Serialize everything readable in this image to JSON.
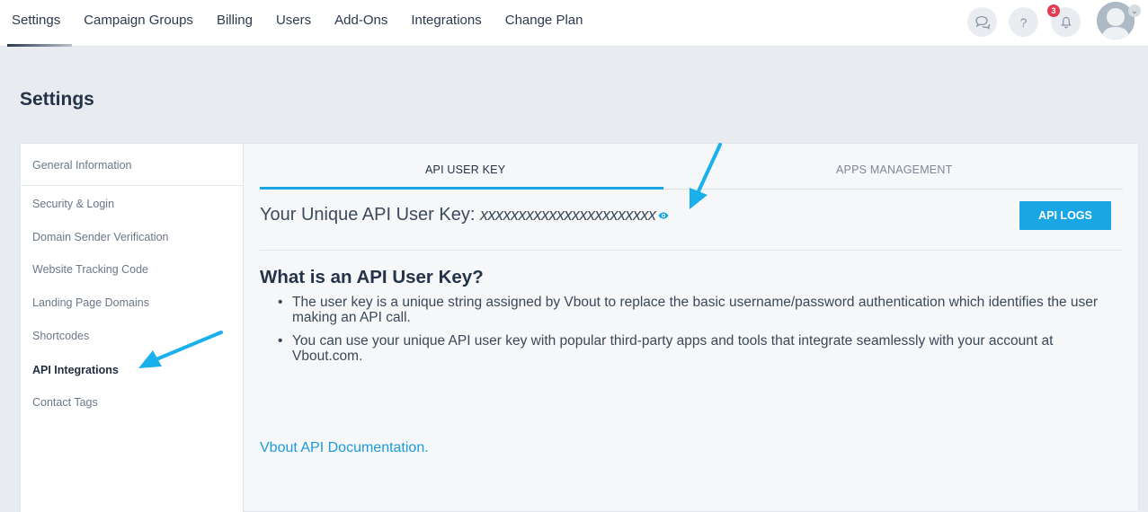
{
  "nav": {
    "items": [
      "Settings",
      "Campaign Groups",
      "Billing",
      "Users",
      "Add-Ons",
      "Integrations",
      "Change Plan"
    ],
    "active": "Settings"
  },
  "header_icons": {
    "chat": "chat-icon",
    "help": "?",
    "notifications_count": "3",
    "bell": "bell-icon"
  },
  "page_title": "Settings",
  "sidebar": {
    "items": [
      "General Information",
      "Security & Login",
      "Domain Sender Verification",
      "Website Tracking Code",
      "Landing Page Domains",
      "Shortcodes",
      "API Integrations",
      "Contact Tags"
    ],
    "active": "API Integrations"
  },
  "tabs": [
    "API USER KEY",
    "APPS MANAGEMENT"
  ],
  "api_key": {
    "label": "Your Unique API User Key:",
    "value": "xxxxxxxxxxxxxxxxxxxxxxx",
    "logs_button": "API LOGS"
  },
  "about": {
    "title": "What is an API User Key?",
    "bullets": [
      "The user key is a unique string assigned by Vbout to replace the basic username/password authentication which identifies the user making an API call.",
      "You can use your unique API user key with popular third-party apps and tools that integrate seamlessly with your account at Vbout.com."
    ]
  },
  "doc_link": "Vbout API Documentation.",
  "colors": {
    "accent": "#1aa6e4",
    "annotation_arrow": "#1ab0ec",
    "badge": "#e23d51",
    "text_dark": "#243349"
  }
}
